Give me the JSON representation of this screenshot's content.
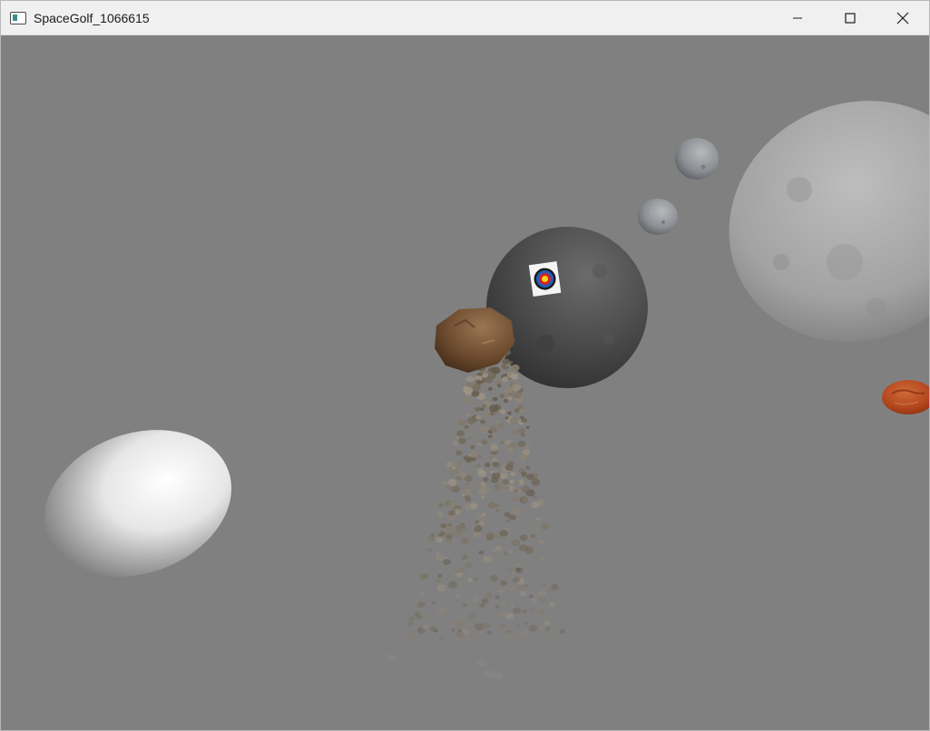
{
  "window": {
    "title": "SpaceGolf_1066615",
    "icon": "app-window-icon",
    "controls": {
      "minimize_icon": "minimize-icon",
      "maximize_icon": "maximize-icon",
      "close_icon": "close-icon"
    }
  },
  "scene": {
    "background_color": "#808080",
    "objects": [
      {
        "name": "white-egg-planet",
        "color": "#e8e8e8"
      },
      {
        "name": "dark-target-planet",
        "color": "#4a4a4a"
      },
      {
        "name": "target-marker",
        "color": "#1e5fbf"
      },
      {
        "name": "brown-asteroid",
        "color": "#6b4a2e"
      },
      {
        "name": "small-gray-moon-upper",
        "color": "#8c8f93"
      },
      {
        "name": "small-gray-moon-lower",
        "color": "#8a8d91"
      },
      {
        "name": "large-gray-moon",
        "color": "#a8a8a8"
      },
      {
        "name": "red-planet",
        "color": "#b2451c"
      },
      {
        "name": "debris-particles",
        "color": "#7a6a5a"
      }
    ]
  }
}
